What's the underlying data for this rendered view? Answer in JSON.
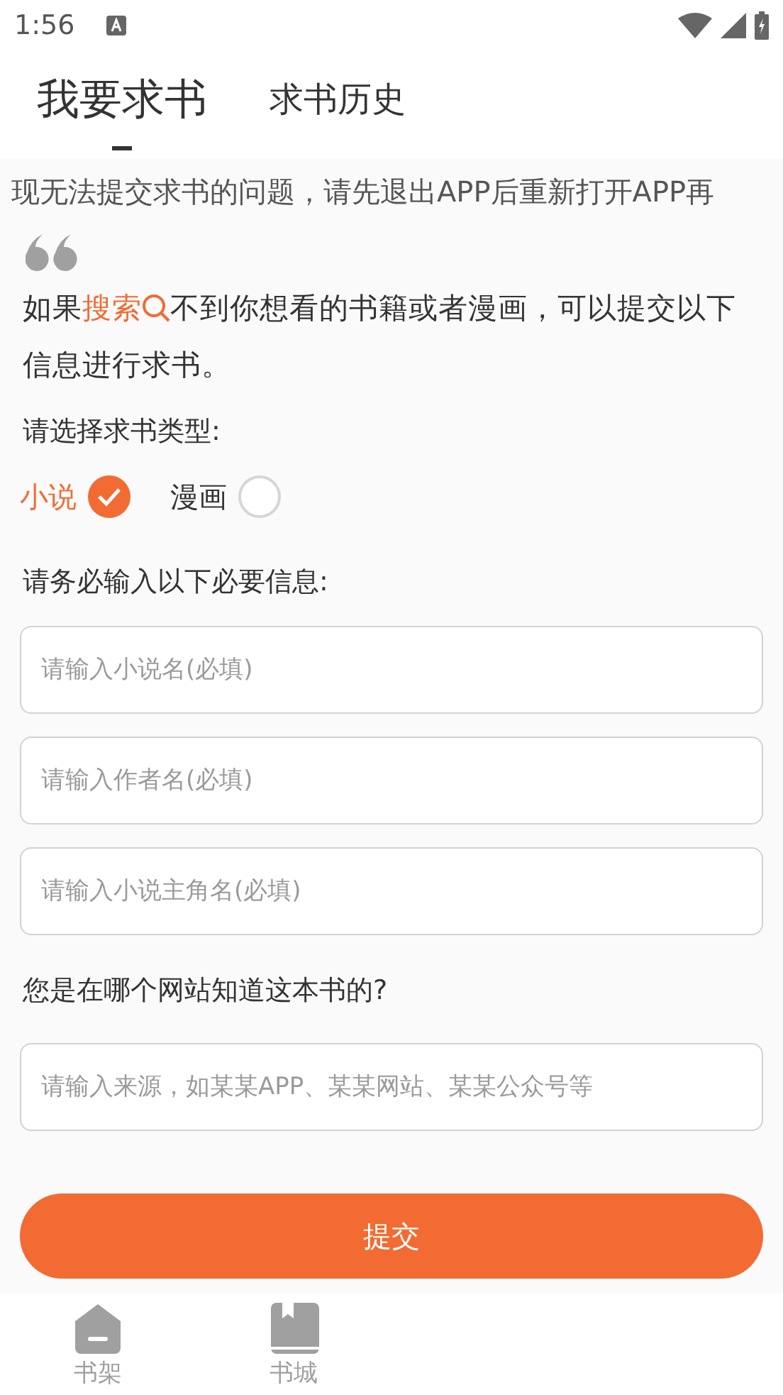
{
  "status_bar": {
    "time": "1:56"
  },
  "tabs": [
    {
      "label": "我要求书",
      "selected": true
    },
    {
      "label": "求书历史",
      "selected": false
    }
  ],
  "notice": "现无法提交求书的问题，请先退出APP后重新打开APP再",
  "intro": {
    "before": "如果",
    "link": "搜索",
    "after": "不到你想看的书籍或者漫画，可以提交以下信息进行求书。"
  },
  "type_label": "请选择求书类型:",
  "types": [
    {
      "label": "小说",
      "selected": true
    },
    {
      "label": "漫画",
      "selected": false
    }
  ],
  "required_label": "请务必输入以下必要信息:",
  "required_fields": [
    {
      "placeholder": "请输入小说名(必填)"
    },
    {
      "placeholder": "请输入作者名(必填)"
    },
    {
      "placeholder": "请输入小说主角名(必填)"
    }
  ],
  "source_label": "您是在哪个网站知道这本书的?",
  "source_field": {
    "placeholder": "请输入来源，如某某APP、某某网站、某某公众号等"
  },
  "submit": "提交",
  "bottom_nav": [
    {
      "label": "书架",
      "kind": "house",
      "selected": false
    },
    {
      "label": "书城",
      "kind": "book",
      "selected": false
    }
  ]
}
